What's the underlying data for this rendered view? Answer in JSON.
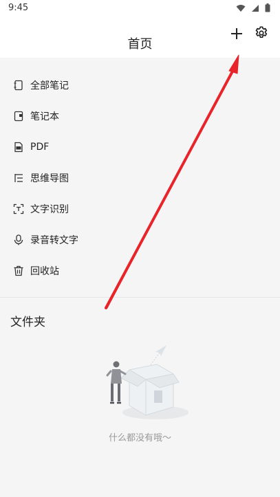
{
  "status_bar": {
    "time": "9:45"
  },
  "header": {
    "title": "首页"
  },
  "menu": {
    "items": [
      {
        "label": "全部笔记",
        "icon": "all-notes-icon"
      },
      {
        "label": "笔记本",
        "icon": "notebook-icon"
      },
      {
        "label": "PDF",
        "icon": "pdf-icon"
      },
      {
        "label": "思维导图",
        "icon": "mind-map-icon"
      },
      {
        "label": "文字识别",
        "icon": "text-recognition-icon"
      },
      {
        "label": "录音转文字",
        "icon": "voice-to-text-icon"
      },
      {
        "label": "回收站",
        "icon": "trash-icon"
      }
    ]
  },
  "folders": {
    "title": "文件夹",
    "empty_text": "什么都没有哦～"
  },
  "colors": {
    "arrow": "#e8242a",
    "icon": "#333333",
    "muted": "#999999"
  }
}
